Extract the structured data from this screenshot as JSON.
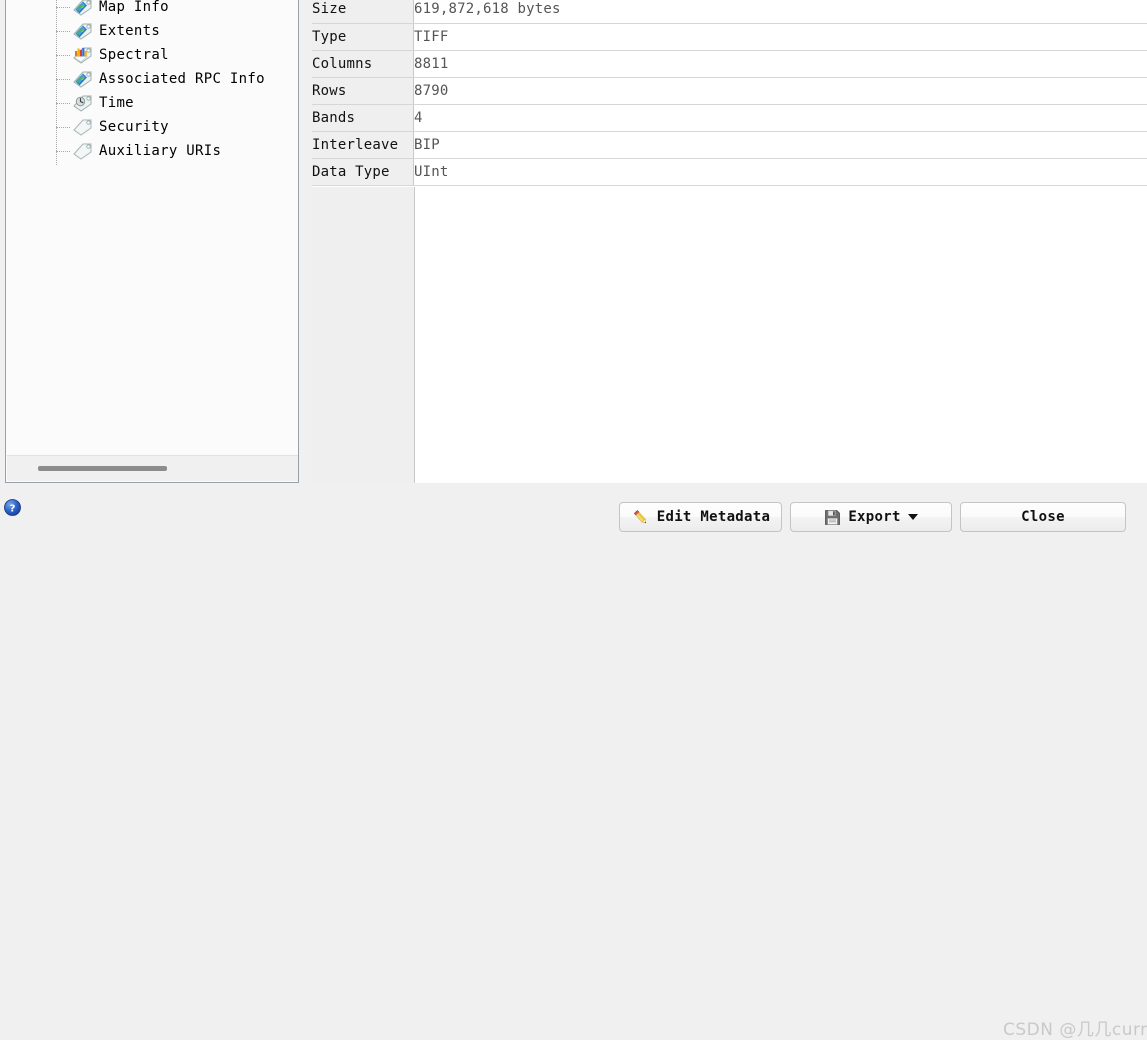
{
  "tree": {
    "items": [
      {
        "label": "Map Info",
        "icon": "globe-tag-icon"
      },
      {
        "label": "Extents",
        "icon": "globe-tag-icon"
      },
      {
        "label": "Spectral",
        "icon": "spectral-tag-icon"
      },
      {
        "label": "Associated RPC Info",
        "icon": "globe-tag-icon"
      },
      {
        "label": "Time",
        "icon": "clock-tag-icon"
      },
      {
        "label": "Security",
        "icon": "blank-tag-icon"
      },
      {
        "label": "Auxiliary URIs",
        "icon": "blank-tag-icon"
      }
    ]
  },
  "metadata": {
    "rows": [
      {
        "key": "Size",
        "value": "619,872,618 bytes"
      },
      {
        "key": "Type",
        "value": "TIFF"
      },
      {
        "key": "Columns",
        "value": "8811"
      },
      {
        "key": "Rows",
        "value": "8790"
      },
      {
        "key": "Bands",
        "value": "4"
      },
      {
        "key": "Interleave",
        "value": "BIP"
      },
      {
        "key": "Data Type",
        "value": "UInt"
      }
    ]
  },
  "footer": {
    "help_icon": "help-question-icon",
    "edit_metadata_label": "Edit Metadata",
    "edit_metadata_icon": "pencil-icon",
    "export_label": "Export",
    "export_icon": "floppy-disk-icon",
    "export_caret_icon": "chevron-down-icon",
    "close_label": "Close",
    "watermark": "CSDN @几几curry"
  },
  "colors": {
    "panel_border": "#9aa0a8",
    "key_cell_bg": "#efefef",
    "row_divider": "#d6d6d6",
    "footer_bg": "#f0f0f0",
    "help_blue": "#2a63c4",
    "watermark_gray": "#c9c9c9"
  }
}
